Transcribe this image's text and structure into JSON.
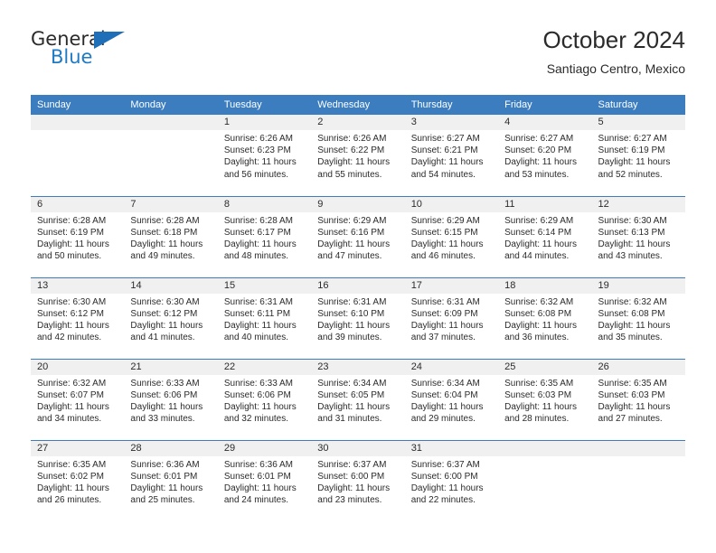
{
  "brand": {
    "name_part1": "General",
    "name_part2": "Blue",
    "accent_color": "#1f7ac4",
    "triangle_icon": "blue-triangle-icon"
  },
  "header": {
    "title": "October 2024",
    "subtitle": "Santiago Centro, Mexico"
  },
  "colors": {
    "header_blue": "#3c7dbf",
    "daynum_band": "#f0f0f0",
    "text": "#2b2b2b"
  },
  "calendar": {
    "weekday_headers": [
      "Sunday",
      "Monday",
      "Tuesday",
      "Wednesday",
      "Thursday",
      "Friday",
      "Saturday"
    ],
    "weeks": [
      [
        {
          "day": "",
          "lines": []
        },
        {
          "day": "",
          "lines": []
        },
        {
          "day": "1",
          "lines": [
            "Sunrise: 6:26 AM",
            "Sunset: 6:23 PM",
            "Daylight: 11 hours and 56 minutes."
          ]
        },
        {
          "day": "2",
          "lines": [
            "Sunrise: 6:26 AM",
            "Sunset: 6:22 PM",
            "Daylight: 11 hours and 55 minutes."
          ]
        },
        {
          "day": "3",
          "lines": [
            "Sunrise: 6:27 AM",
            "Sunset: 6:21 PM",
            "Daylight: 11 hours and 54 minutes."
          ]
        },
        {
          "day": "4",
          "lines": [
            "Sunrise: 6:27 AM",
            "Sunset: 6:20 PM",
            "Daylight: 11 hours and 53 minutes."
          ]
        },
        {
          "day": "5",
          "lines": [
            "Sunrise: 6:27 AM",
            "Sunset: 6:19 PM",
            "Daylight: 11 hours and 52 minutes."
          ]
        }
      ],
      [
        {
          "day": "6",
          "lines": [
            "Sunrise: 6:28 AM",
            "Sunset: 6:19 PM",
            "Daylight: 11 hours and 50 minutes."
          ]
        },
        {
          "day": "7",
          "lines": [
            "Sunrise: 6:28 AM",
            "Sunset: 6:18 PM",
            "Daylight: 11 hours and 49 minutes."
          ]
        },
        {
          "day": "8",
          "lines": [
            "Sunrise: 6:28 AM",
            "Sunset: 6:17 PM",
            "Daylight: 11 hours and 48 minutes."
          ]
        },
        {
          "day": "9",
          "lines": [
            "Sunrise: 6:29 AM",
            "Sunset: 6:16 PM",
            "Daylight: 11 hours and 47 minutes."
          ]
        },
        {
          "day": "10",
          "lines": [
            "Sunrise: 6:29 AM",
            "Sunset: 6:15 PM",
            "Daylight: 11 hours and 46 minutes."
          ]
        },
        {
          "day": "11",
          "lines": [
            "Sunrise: 6:29 AM",
            "Sunset: 6:14 PM",
            "Daylight: 11 hours and 44 minutes."
          ]
        },
        {
          "day": "12",
          "lines": [
            "Sunrise: 6:30 AM",
            "Sunset: 6:13 PM",
            "Daylight: 11 hours and 43 minutes."
          ]
        }
      ],
      [
        {
          "day": "13",
          "lines": [
            "Sunrise: 6:30 AM",
            "Sunset: 6:12 PM",
            "Daylight: 11 hours and 42 minutes."
          ]
        },
        {
          "day": "14",
          "lines": [
            "Sunrise: 6:30 AM",
            "Sunset: 6:12 PM",
            "Daylight: 11 hours and 41 minutes."
          ]
        },
        {
          "day": "15",
          "lines": [
            "Sunrise: 6:31 AM",
            "Sunset: 6:11 PM",
            "Daylight: 11 hours and 40 minutes."
          ]
        },
        {
          "day": "16",
          "lines": [
            "Sunrise: 6:31 AM",
            "Sunset: 6:10 PM",
            "Daylight: 11 hours and 39 minutes."
          ]
        },
        {
          "day": "17",
          "lines": [
            "Sunrise: 6:31 AM",
            "Sunset: 6:09 PM",
            "Daylight: 11 hours and 37 minutes."
          ]
        },
        {
          "day": "18",
          "lines": [
            "Sunrise: 6:32 AM",
            "Sunset: 6:08 PM",
            "Daylight: 11 hours and 36 minutes."
          ]
        },
        {
          "day": "19",
          "lines": [
            "Sunrise: 6:32 AM",
            "Sunset: 6:08 PM",
            "Daylight: 11 hours and 35 minutes."
          ]
        }
      ],
      [
        {
          "day": "20",
          "lines": [
            "Sunrise: 6:32 AM",
            "Sunset: 6:07 PM",
            "Daylight: 11 hours and 34 minutes."
          ]
        },
        {
          "day": "21",
          "lines": [
            "Sunrise: 6:33 AM",
            "Sunset: 6:06 PM",
            "Daylight: 11 hours and 33 minutes."
          ]
        },
        {
          "day": "22",
          "lines": [
            "Sunrise: 6:33 AM",
            "Sunset: 6:06 PM",
            "Daylight: 11 hours and 32 minutes."
          ]
        },
        {
          "day": "23",
          "lines": [
            "Sunrise: 6:34 AM",
            "Sunset: 6:05 PM",
            "Daylight: 11 hours and 31 minutes."
          ]
        },
        {
          "day": "24",
          "lines": [
            "Sunrise: 6:34 AM",
            "Sunset: 6:04 PM",
            "Daylight: 11 hours and 29 minutes."
          ]
        },
        {
          "day": "25",
          "lines": [
            "Sunrise: 6:35 AM",
            "Sunset: 6:03 PM",
            "Daylight: 11 hours and 28 minutes."
          ]
        },
        {
          "day": "26",
          "lines": [
            "Sunrise: 6:35 AM",
            "Sunset: 6:03 PM",
            "Daylight: 11 hours and 27 minutes."
          ]
        }
      ],
      [
        {
          "day": "27",
          "lines": [
            "Sunrise: 6:35 AM",
            "Sunset: 6:02 PM",
            "Daylight: 11 hours and 26 minutes."
          ]
        },
        {
          "day": "28",
          "lines": [
            "Sunrise: 6:36 AM",
            "Sunset: 6:01 PM",
            "Daylight: 11 hours and 25 minutes."
          ]
        },
        {
          "day": "29",
          "lines": [
            "Sunrise: 6:36 AM",
            "Sunset: 6:01 PM",
            "Daylight: 11 hours and 24 minutes."
          ]
        },
        {
          "day": "30",
          "lines": [
            "Sunrise: 6:37 AM",
            "Sunset: 6:00 PM",
            "Daylight: 11 hours and 23 minutes."
          ]
        },
        {
          "day": "31",
          "lines": [
            "Sunrise: 6:37 AM",
            "Sunset: 6:00 PM",
            "Daylight: 11 hours and 22 minutes."
          ]
        },
        {
          "day": "",
          "lines": []
        },
        {
          "day": "",
          "lines": []
        }
      ]
    ]
  }
}
